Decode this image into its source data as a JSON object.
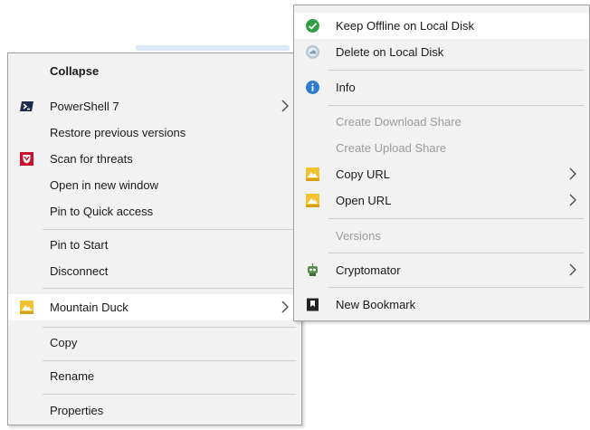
{
  "main_menu": {
    "items": [
      {
        "label": "Collapse"
      },
      {
        "label": "PowerShell 7"
      },
      {
        "label": "Restore previous versions"
      },
      {
        "label": "Scan for threats"
      },
      {
        "label": "Open in new window"
      },
      {
        "label": "Pin to Quick access"
      },
      {
        "label": "Pin to Start"
      },
      {
        "label": "Disconnect"
      },
      {
        "label": "Mountain Duck"
      },
      {
        "label": "Copy"
      },
      {
        "label": "Rename"
      },
      {
        "label": "Properties"
      }
    ]
  },
  "sub_menu": {
    "items": [
      {
        "label": "Keep Offline on Local Disk"
      },
      {
        "label": "Delete on Local Disk"
      },
      {
        "label": "Info"
      },
      {
        "label": "Create Download Share"
      },
      {
        "label": "Create Upload Share"
      },
      {
        "label": "Copy URL"
      },
      {
        "label": "Open URL"
      },
      {
        "label": "Versions"
      },
      {
        "label": "Cryptomator"
      },
      {
        "label": "New Bookmark"
      }
    ]
  },
  "colors": {
    "menu_bg": "#f2f2f2",
    "highlight": "#ffffff",
    "disabled_text": "#9c9c9c",
    "check_green": "#2ea043",
    "info_blue": "#2f7dd1",
    "mcafee_red": "#c8102e",
    "duck_yellow": "#f2c230"
  }
}
